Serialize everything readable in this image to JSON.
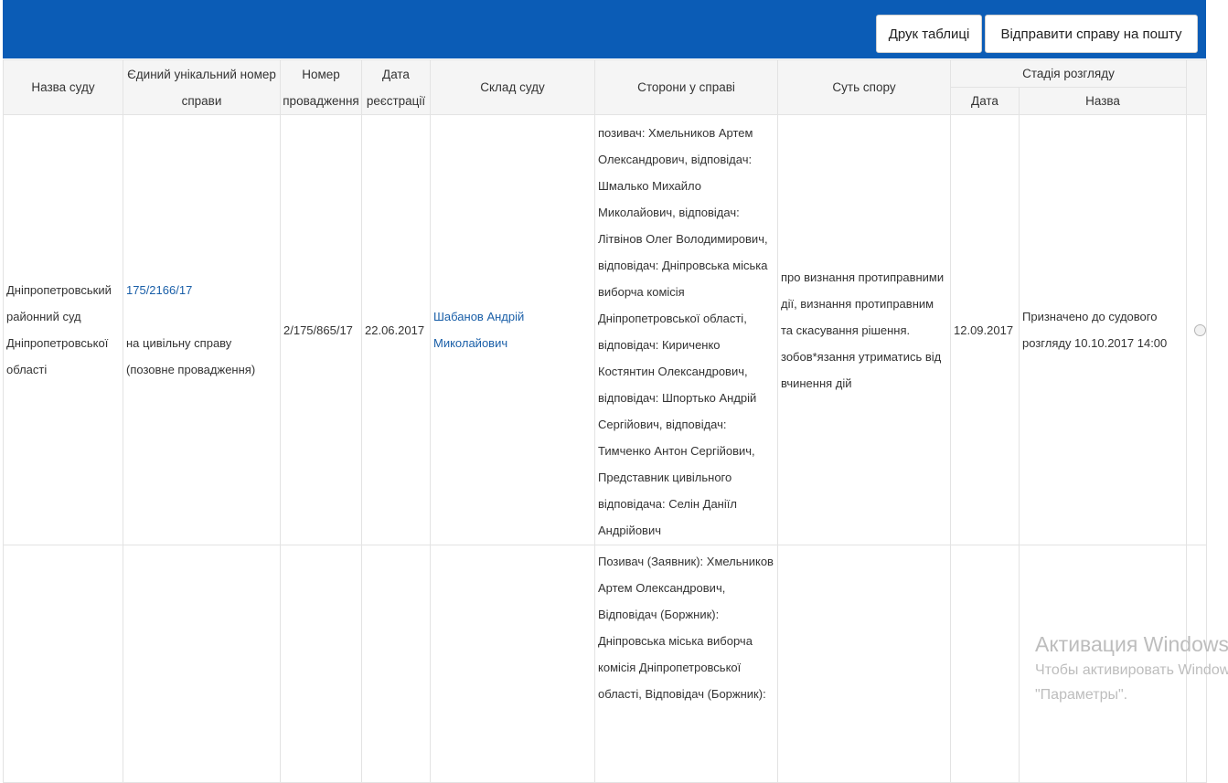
{
  "toolbar": {
    "print_label": "Друк таблиці",
    "email_label": "Відправити справу на пошту",
    "bar_color": "#0b5cb6"
  },
  "table": {
    "headers": {
      "court": "Назва суду",
      "case_number": "Єдиний унікальний номер справи",
      "proceeding_number": "Номер провадження",
      "registration_date": "Дата реєстрації",
      "composition": "Склад суду",
      "parties": "Сторони у справі",
      "subject": "Суть спору",
      "stage": "Стадія розгляду",
      "stage_date": "Дата",
      "stage_name": "Назва"
    },
    "rows": [
      {
        "court": "Дніпропетровський районний суд Дніпропетровської області",
        "case_number": "175/2166/17",
        "case_type": "на цивільну справу (позовне провадження)",
        "proceeding_number": "2/175/865/17",
        "registration_date": "22.06.2017",
        "composition": "Шабанов Андрій Миколайович",
        "parties": "позивач: Хмельников Артем Олександрович, відповідач: Шмалько Михайло Миколайович, відповідач: Літвінов Олег Володимирович, відповідач: Дніпровська міська виборча комісія Дніпропетровської області, відповідач: Кириченко Костянтин Олександрович, відповідач: Шпортько Андрій Сергійович, відповідач: Тимченко Антон Сергійович, Представник цивільного відповідача: Селін Даніїл Андрійович",
        "subject": "про визнання протиправними дії, визнання протиправним та скасування рішення. зобов*язання утриматись від вчинення дій",
        "stage_date": "12.09.2017",
        "stage_name": "Призначено до судового розгляду 10.10.2017 14:00"
      },
      {
        "court": "",
        "case_number": "",
        "case_type": "",
        "proceeding_number": "",
        "registration_date": "",
        "composition": "",
        "parties": "Позивач (Заявник): Хмельников Артем Олександрович, Відповідач (Боржник): Дніпровська міська виборча комісія Дніпропетровської області, Відповідач (Боржник):",
        "subject": "",
        "stage_date": "",
        "stage_name": ""
      }
    ]
  },
  "watermark": {
    "title": "Активация Windows",
    "line1": "Чтобы активировать Windows, перейдите в раздел",
    "line2": "\"Параметры\"."
  }
}
